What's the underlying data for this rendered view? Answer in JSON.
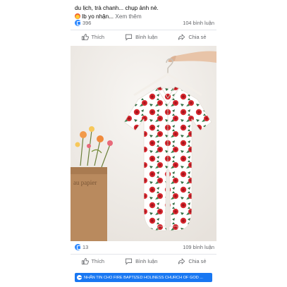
{
  "post": {
    "caption_cut": "",
    "caption_line1": "du lịch, trà chanh... chụp ảnh nè.",
    "caption_line2": "Ib yo nhận...",
    "see_more": "Xem thêm"
  },
  "stats_top": {
    "reactions": "396",
    "comments": "104 bình luận"
  },
  "stats_bottom": {
    "reactions": "13",
    "comments": "109 bình luận"
  },
  "actions": {
    "like": "Thích",
    "comment": "Bình luận",
    "share": "Chia sẻ"
  },
  "photo": {
    "bag_text": "au papier",
    "colors": {
      "fabric": "#ffffff",
      "rose": "#d7282f",
      "leaf": "#2f6b3f",
      "wall": "#f1eeea",
      "bag": "#b98a5e"
    }
  },
  "cta": {
    "label": "NHẮN TIN CHO FIRE BAPTIZED HOLINESS CHURCH OF GOD ..."
  },
  "icons": [
    "thumbs-up-icon",
    "comment-icon",
    "share-icon",
    "messenger-icon",
    "fire-emoji-icon"
  ]
}
